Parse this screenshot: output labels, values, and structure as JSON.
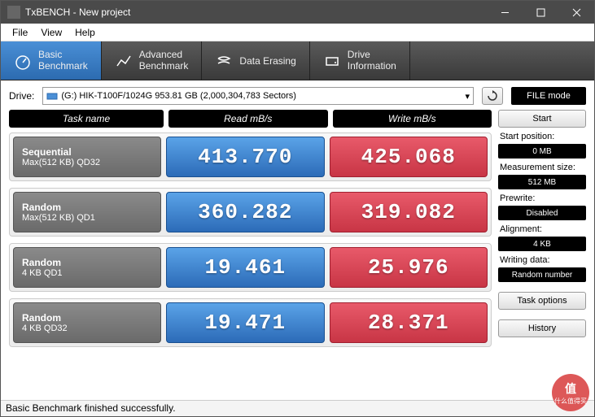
{
  "window": {
    "title": "TxBENCH - New project"
  },
  "menu": {
    "file": "File",
    "view": "View",
    "help": "Help"
  },
  "tabs": {
    "basic": "Basic\nBenchmark",
    "advanced": "Advanced\nBenchmark",
    "erasing": "Data Erasing",
    "driveinfo": "Drive\nInformation"
  },
  "drive": {
    "label": "Drive:",
    "value": "(G:) HIK-T100F/1024G  953.81 GB (2,000,304,783 Sectors)",
    "filemode": "FILE mode"
  },
  "headers": {
    "task": "Task name",
    "read": "Read mB/s",
    "write": "Write mB/s"
  },
  "rows": [
    {
      "title": "Sequential",
      "sub": "Max(512 KB) QD32",
      "read": "413.770",
      "write": "425.068"
    },
    {
      "title": "Random",
      "sub": "Max(512 KB) QD1",
      "read": "360.282",
      "write": "319.082"
    },
    {
      "title": "Random",
      "sub": "4 KB QD1",
      "read": "19.461",
      "write": "25.976"
    },
    {
      "title": "Random",
      "sub": "4 KB QD32",
      "read": "19.471",
      "write": "28.371"
    }
  ],
  "side": {
    "start": "Start",
    "startpos_l": "Start position:",
    "startpos_v": "0 MB",
    "msize_l": "Measurement size:",
    "msize_v": "512 MB",
    "prewrite_l": "Prewrite:",
    "prewrite_v": "Disabled",
    "align_l": "Alignment:",
    "align_v": "4 KB",
    "wdata_l": "Writing data:",
    "wdata_v": "Random number",
    "taskopt": "Task options",
    "history": "History"
  },
  "status": "Basic Benchmark finished successfully.",
  "watermark": {
    "big": "值",
    "small": "什么值得买"
  },
  "chart_data": {
    "type": "table",
    "title": "TxBENCH Basic Benchmark Results",
    "columns": [
      "Task name",
      "Read mB/s",
      "Write mB/s"
    ],
    "rows": [
      [
        "Sequential Max(512 KB) QD32",
        413.77,
        425.068
      ],
      [
        "Random Max(512 KB) QD1",
        360.282,
        319.082
      ],
      [
        "Random 4 KB QD1",
        19.461,
        25.976
      ],
      [
        "Random 4 KB QD32",
        19.471,
        28.371
      ]
    ]
  }
}
